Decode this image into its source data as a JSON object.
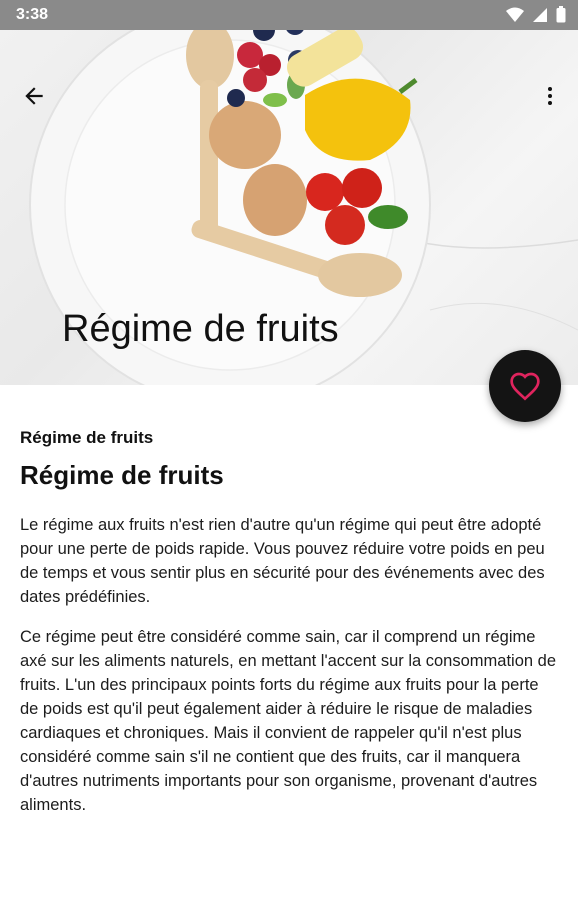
{
  "status_bar": {
    "time": "3:38"
  },
  "toolbar": {
    "back_icon": "arrow-back-icon",
    "menu_icon": "more-vert-icon"
  },
  "hero": {
    "title": "Régime de fruits"
  },
  "fab": {
    "icon": "heart-outline-icon",
    "icon_color": "#e0245e"
  },
  "article": {
    "subtitle": "Régime de fruits",
    "headline": "Régime de fruits",
    "paragraphs": [
      "Le régime aux fruits n'est rien d'autre qu'un régime qui peut être adopté pour une perte de poids rapide. Vous pouvez réduire votre poids en peu de temps et vous sentir plus en sécurité pour des événements avec des dates prédéfinies.",
      "Ce régime peut être considéré comme sain, car il comprend un régime axé sur les aliments naturels, en mettant l'accent sur la consommation de fruits. L'un des principaux points forts du régime aux fruits pour la perte de poids est qu'il peut également aider à réduire le risque de maladies cardiaques et chroniques. Mais il convient de rappeler qu'il n'est plus considéré comme sain s'il ne contient que des fruits, car il manquera d'autres nutriments importants pour son organisme, provenant d'autres aliments."
    ]
  }
}
